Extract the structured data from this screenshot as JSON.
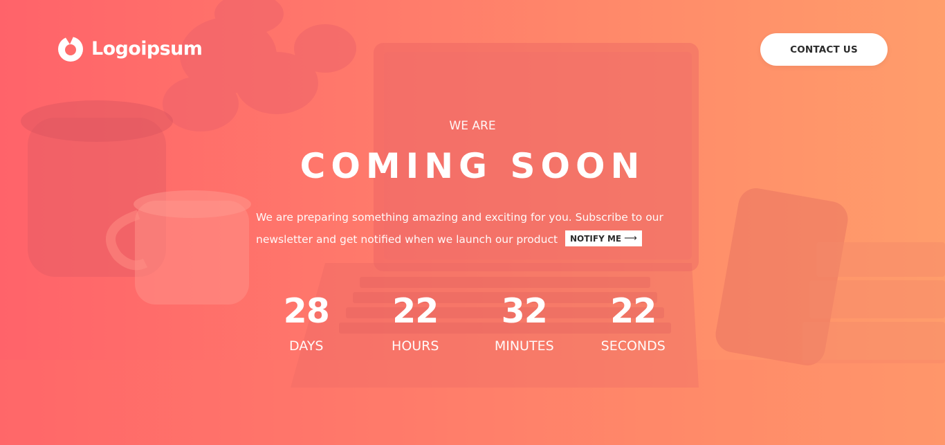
{
  "header": {
    "logo_text": "Logoipsum",
    "contact_label": "CONTACT US"
  },
  "hero": {
    "eyebrow": "WE ARE",
    "headline": "COMING SOON",
    "description": "We are preparing something amazing and exciting for you. Subscribe to our newsletter and get notified when we launch our product",
    "notify_label": "NOTIFY ME",
    "notify_arrow": "⟶"
  },
  "countdown": [
    {
      "value": "28",
      "label": "DAYS"
    },
    {
      "value": "22",
      "label": "HOURS"
    },
    {
      "value": "32",
      "label": "MINUTES"
    },
    {
      "value": "22",
      "label": "SECONDS"
    }
  ],
  "theme": {
    "gradient_start": "#ff636a",
    "gradient_end": "#ff9d6b",
    "button_bg": "#ffffff",
    "button_text": "#2b2b2b"
  },
  "icons": {
    "logo": "logo-mark-icon",
    "notify_arrow": "arrow-right-icon"
  }
}
